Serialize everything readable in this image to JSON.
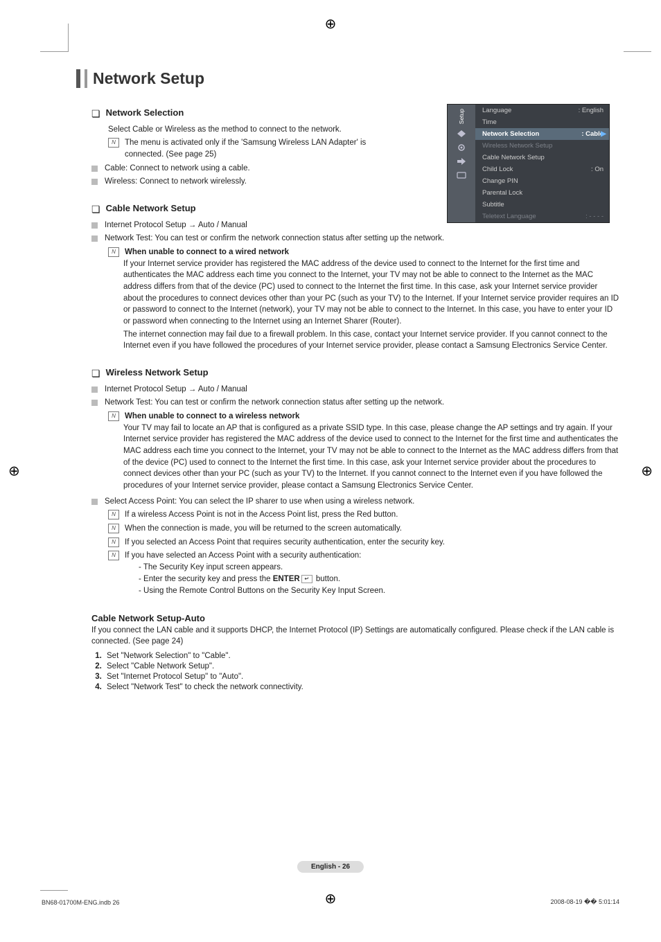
{
  "title": "Network Setup",
  "sec1": {
    "heading": "Network Selection",
    "intro": "Select Cable or Wireless as the method to connect to the network.",
    "note1": "The menu is activated only if the 'Samsung Wireless LAN Adapter' is connected. (See page 25)",
    "bul1": "Cable: Connect to network using a cable.",
    "bul2": "Wireless: Connect to network wirelessly."
  },
  "sec2": {
    "heading": "Cable Network Setup",
    "bul1": "Internet Protocol Setup → Auto / Manual",
    "bul2": "Network Test: You can test or confirm the network connection status after setting up the network.",
    "note_head": "When unable to connect to a wired network",
    "note_body1": "If your Internet service provider has registered the MAC address of the device used to connect to the Internet for the first time and authenticates the MAC address each time you connect to the Internet, your TV may not be able to connect to the Internet as the MAC address differs from that of the device (PC) used to connect to the Internet the first time. In this case, ask your Internet service provider about the procedures to connect devices other than your PC (such as your TV) to the Internet. If your Internet service provider requires an ID or password to connect to the Internet (network), your TV may not be able to connect to the Internet. In this case, you have to enter your ID or password when connecting to the Internet using an Internet Sharer (Router).",
    "note_body2": "The internet connection may fail due to a firewall problem. In this case, contact your Internet service provider. If you cannot connect to the Internet even if you have followed the procedures of your Internet service provider, please contact a Samsung Electronics Service Center."
  },
  "sec3": {
    "heading": "Wireless Network Setup",
    "bul1": "Internet Protocol Setup → Auto / Manual",
    "bul2": "Network Test: You can test or confirm the network connection status after setting up the network.",
    "note_head": "When unable to connect to a wireless network",
    "note_body": "Your TV may fail to locate an AP that is configured as a private SSID type. In this case, please change the AP settings and try again. If your Internet service provider has registered the MAC address of the device used to connect to the Internet for the first time and authenticates the MAC address each time you connect to the Internet, your TV may not be able to connect to the Internet as the MAC address differs from that of the device (PC) used to connect to the Internet the first time. In this case, ask your Internet service provider about the procedures to connect devices other than your PC (such as your TV) to the Internet. If you cannot connect to the Internet even if you have followed the procedures of your Internet service provider, please contact a Samsung Electronics Service Center.",
    "bul3": "Select Access Point: You can select the IP sharer to use when using a wireless network.",
    "n1": "If a wireless Access Point is not in the Access Point list, press the Red button.",
    "n2": "When the connection is made, you will be returned to the screen automatically.",
    "n3": "If you selected an Access Point that requires security authentication, enter the security key.",
    "n4": "If you have selected an Access Point with a security authentication:",
    "d1": "The Security Key input screen appears.",
    "d2a": "Enter the security key and press the ",
    "d2b": "ENTER",
    "d2c": " button.",
    "d3": "Using the Remote Control Buttons on the Security Key Input Screen."
  },
  "sec4": {
    "heading": "Cable Network Setup-Auto",
    "intro": "If you connect the LAN cable and it supports DHCP, the Internet Protocol (IP) Settings are automatically configured. Please check if the LAN cable is connected. (See page 24)",
    "s1": "Set \"Network Selection\" to \"Cable\".",
    "s2": "Select \"Cable Network Setup\".",
    "s3": "Set \"Internet Protocol Setup\" to \"Auto\".",
    "s4": "Select \"Network Test\" to check the network connectivity."
  },
  "osd": {
    "tab": "Setup",
    "rows": [
      {
        "l": "Language",
        "v": ": English",
        "dim": false
      },
      {
        "l": "Time",
        "v": "",
        "dim": false
      },
      {
        "l": "Network Selection",
        "v": ": Cable",
        "sel": true
      },
      {
        "l": "Wireless Network Setup",
        "v": "",
        "dim": true
      },
      {
        "l": "Cable Network Setup",
        "v": "",
        "dim": false
      },
      {
        "l": "Child Lock",
        "v": ": On",
        "dim": false
      },
      {
        "l": "Change PIN",
        "v": "",
        "dim": false
      },
      {
        "l": "Parental Lock",
        "v": "",
        "dim": false
      },
      {
        "l": "Subtitle",
        "v": "",
        "dim": false
      },
      {
        "l": "Teletext Language",
        "v": ": - - - -",
        "dim": true
      }
    ]
  },
  "footer": {
    "page": "English - 26",
    "left": "BN68-01700M-ENG.indb   26",
    "right": "2008-08-19   �� 5:01:14"
  }
}
